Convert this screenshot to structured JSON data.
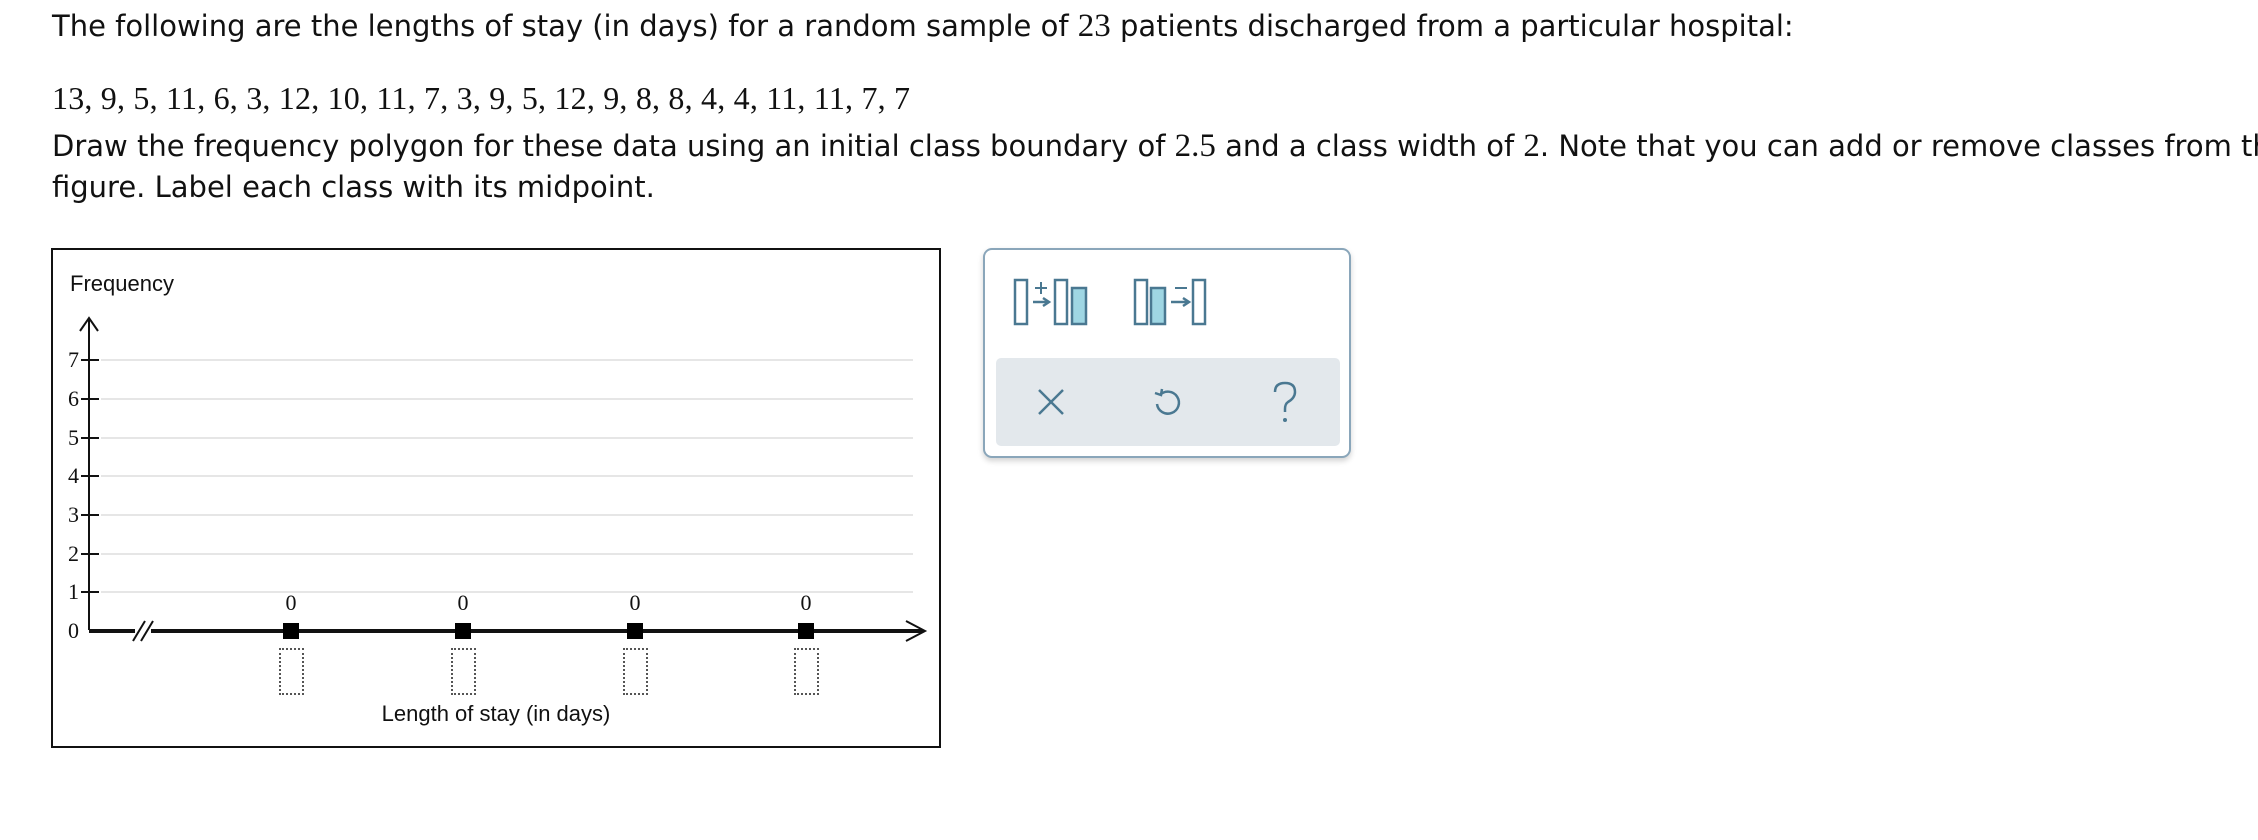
{
  "question": {
    "intro_before": "The following are the lengths of stay (in days) for a random sample of ",
    "sample_size": "23",
    "intro_after": " patients discharged from a particular hospital:",
    "dataset": "13, 9, 5, 11, 6, 3, 12, 10, 11, 7, 3, 9, 5, 12, 9, 8, 8, 4, 4, 11, 11, 7, 7",
    "instr_part1": "Draw the frequency polygon for these data using an initial class boundary of ",
    "initial_boundary": "2.5",
    "instr_part2": " and a class width of ",
    "class_width": "2",
    "instr_part3": ". Note that you can add or remove classes from the",
    "instr_line2": "figure. Label each class with its midpoint."
  },
  "graph": {
    "y_axis_label": "Frequency",
    "x_axis_label": "Length of stay (in days)",
    "y_ticks": [
      "0",
      "1",
      "2",
      "3",
      "4",
      "5",
      "6",
      "7"
    ],
    "point_values": [
      "0",
      "0",
      "0",
      "0"
    ],
    "midpoint_inputs": [
      "",
      "",
      "",
      ""
    ]
  },
  "toolbar": {
    "add_class_icon": "add-class-icon",
    "remove_class_icon": "remove-class-icon",
    "clear_icon": "close-icon",
    "undo_icon": "undo-icon",
    "help_icon": "help-icon",
    "accent_color": "#4a7891",
    "highlight_color": "#9fd6e3",
    "panel_border_color": "#8aa6ba",
    "action_bar_color": "#e3e8ec"
  }
}
